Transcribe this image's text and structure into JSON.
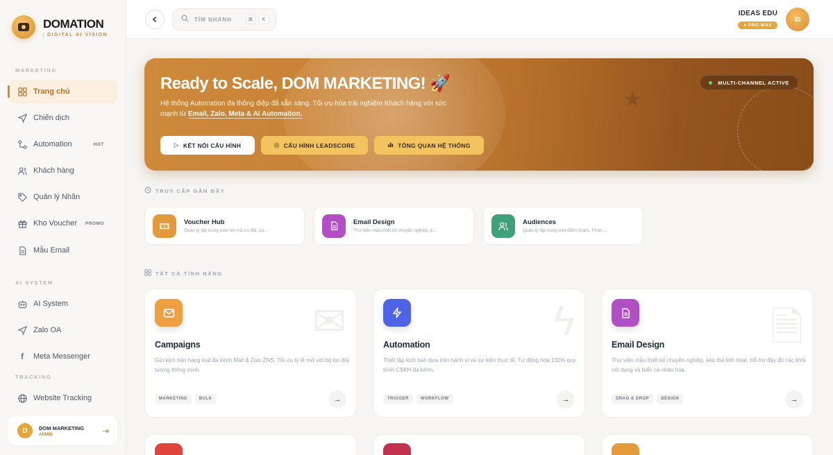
{
  "brand": {
    "name": "DOMATION",
    "sub": "DIGITAL AI VISION"
  },
  "sidebar": {
    "sections": [
      {
        "label": "MARKETING"
      },
      {
        "label": "AI SYSTEM"
      },
      {
        "label": "TRACKING"
      }
    ],
    "items": [
      {
        "label": "Trang chủ",
        "icon": "grid-icon",
        "active": true
      },
      {
        "label": "Chiến dịch",
        "icon": "send-icon"
      },
      {
        "label": "Automation",
        "icon": "flow-icon",
        "badge": "HOT"
      },
      {
        "label": "Khách hàng",
        "icon": "users-icon"
      },
      {
        "label": "Quản lý Nhãn",
        "icon": "tag-icon"
      },
      {
        "label": "Kho Voucher",
        "icon": "gift-icon",
        "badge": "PROMO"
      },
      {
        "label": "Mẫu Email",
        "icon": "file-icon"
      },
      {
        "label": "AI System",
        "icon": "bot-icon"
      },
      {
        "label": "Zalo OA",
        "icon": "send-icon"
      },
      {
        "label": "Meta Messenger",
        "icon": "facebook-icon"
      },
      {
        "label": "Website Tracking",
        "icon": "globe-icon"
      }
    ],
    "user": {
      "name": "DOM MARKETING",
      "role": "ADMIN"
    }
  },
  "topbar": {
    "search_placeholder": "TÌM NHANH",
    "kbd": [
      "⌘",
      "K"
    ],
    "org_name": "IDEAS EDU",
    "org_plan": "PRO MAX",
    "avatar_initials": "ID"
  },
  "hero": {
    "title": "Ready to Scale, DOM MARKETING! 🚀",
    "desc_prefix": "Hệ thống Automation đa thông điệp đã sẵn sàng. Tối ưu hóa trải nghiệm Khách hàng với sức mạnh từ ",
    "desc_strong": "Email, Zalo, Meta & AI Automation.",
    "buttons": [
      "KẾT NỐI CẤU HÌNH",
      "CẤU HÌNH LEADSCORE",
      "TỔNG QUAN HỆ THỐNG"
    ],
    "status": "MULTI-CHANNEL ACTIVE"
  },
  "recent": {
    "title": "TRUY CẬP GẦN ĐÂY",
    "items": [
      {
        "title": "Voucher Hub",
        "desc": "Quản lý tập trung toàn bộ mã ưu đãi, qu...",
        "color": "#e49a3b"
      },
      {
        "title": "Email Design",
        "desc": "Thư viện mẫu thiết kế chuyên nghiệp, k...",
        "color": "#b24fc4"
      },
      {
        "title": "Audiences",
        "desc": "Quản lý tập trung mọi điểm chạm. Phân ...",
        "color": "#3fa07a"
      }
    ]
  },
  "features": {
    "title": "TẤT CẢ TÍNH NĂNG",
    "items": [
      {
        "title": "Campaigns",
        "desc": "Gửi kịch bản hàng loạt đa kênh Mail & Zalo ZNS. Tối ưu tỷ lệ mở với bộ lọc đối tượng thông minh.",
        "tags": [
          "MARKETING",
          "BULK"
        ],
        "color": "#eda03f"
      },
      {
        "title": "Automation",
        "desc": "Thiết lập kịch bản dựa trên hành vi và sự kiện thực tế. Tự động hóa 100% quy trình CSKH đa kênh.",
        "tags": [
          "TRIGGER",
          "WORKFLOW"
        ],
        "color": "#4f63e6"
      },
      {
        "title": "Email Design",
        "desc": "Thư viện mẫu thiết kế chuyên nghiệp, kéo thả linh hoạt. Hỗ trợ đầy đủ các khối nội dung và biến cá nhân hóa.",
        "tags": [
          "DRAG & DROP",
          "DESIGN"
        ],
        "color": "#b24fc4"
      }
    ]
  }
}
